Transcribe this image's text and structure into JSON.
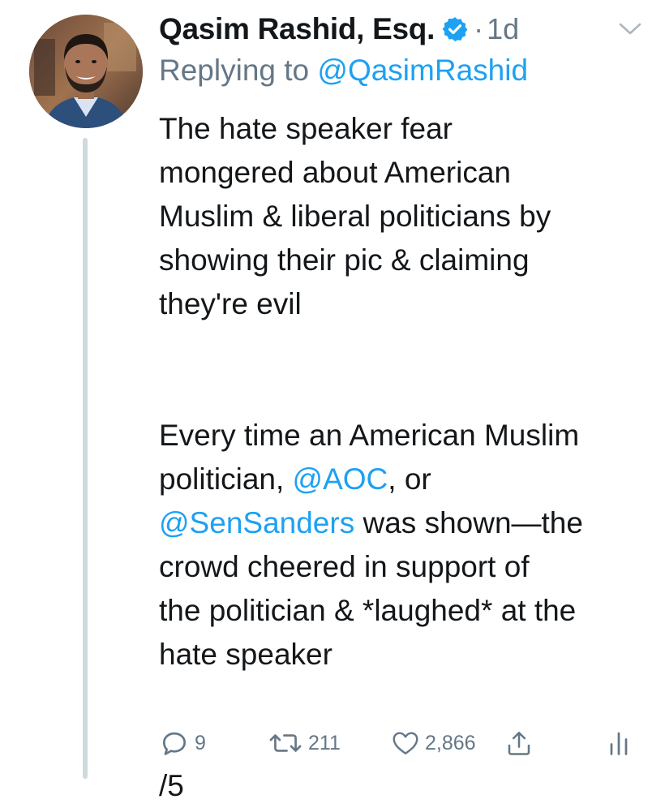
{
  "tweet": {
    "author_name": "Qasim Rashid, Esq.",
    "separator": "·",
    "time_ago": "1d",
    "replying_prefix": "Replying to ",
    "replying_handle": "@QasimRashid",
    "paragraph1": "The hate speaker fear\nmongered about American\nMuslim & liberal politicians by\nshowing their pic & claiming\nthey're evil",
    "paragraph2_a": "Every time an American Muslim\npolitician, ",
    "mention_aoc": "@AOC",
    "paragraph2_b": ", or\n",
    "mention_sanders": "@SenSanders",
    "paragraph2_c": " was shown—the\ncrowd cheered in support of\nthe politician & *laughed* at the\nhate speaker",
    "thread_marker": "/5"
  },
  "actions": {
    "reply_count": "9",
    "retweet_count": "211",
    "like_count": "2,866"
  },
  "icons": {
    "verified": "verified-badge-icon",
    "caret": "chevron-down-icon",
    "reply": "reply-icon",
    "retweet": "retweet-icon",
    "like": "heart-icon",
    "share": "share-icon",
    "analytics": "analytics-icon"
  },
  "colors": {
    "link": "#1da1f2",
    "secondary_text": "#657786",
    "primary_text": "#14171a",
    "thread_line": "#cfd9de"
  }
}
